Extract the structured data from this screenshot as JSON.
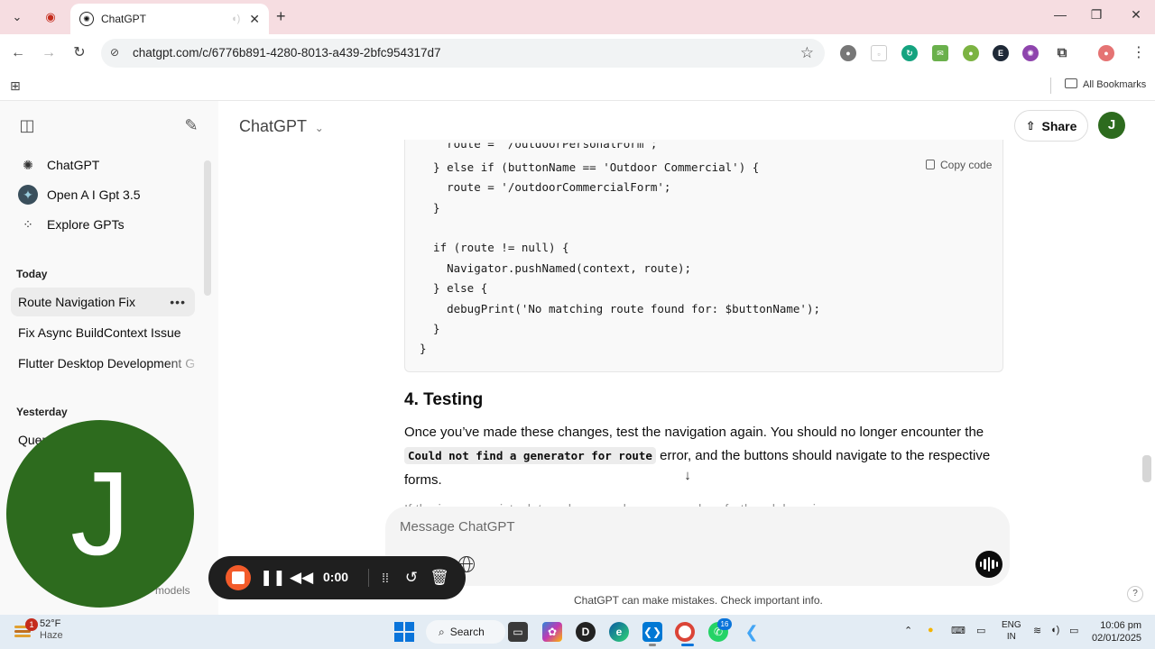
{
  "browser": {
    "tab_title": "ChatGPT",
    "url": "chatgpt.com/c/6776b891-4280-8013-a439-2bfc954317d7",
    "bookmarks_folder": "All Bookmarks",
    "extension_letter": "E"
  },
  "sidebar": {
    "top_items": [
      {
        "label": "ChatGPT",
        "icon": "openai-logo-icon"
      },
      {
        "label": "Open A I Gpt 3.5",
        "icon": "gpt-avatar-icon"
      },
      {
        "label": "Explore GPTs",
        "icon": "grid-icon"
      }
    ],
    "today_label": "Today",
    "today_items": [
      {
        "label": "Route Navigation Fix",
        "active": true
      },
      {
        "label": "Fix Async BuildContext Issue"
      },
      {
        "label": "Flutter Desktop Development Gu"
      }
    ],
    "yesterday_label": "Yesterday",
    "yesterday_partial": "Quer",
    "models_partial": "models"
  },
  "header": {
    "title": "ChatGPT",
    "share_label": "Share",
    "avatar_letter": "J"
  },
  "code": {
    "copy_label": "Copy code",
    "lines": [
      "    route = '/outdoorPersonalForm';",
      "  } else if (buttonName == 'Outdoor Commercial') {",
      "    route = '/outdoorCommercialForm';",
      "  }",
      "",
      "  if (route != null) {",
      "    Navigator.pushNamed(context, route);",
      "  } else {",
      "    debugPrint('No matching route found for: $buttonName');",
      "  }",
      "}"
    ]
  },
  "content": {
    "section_heading": "4. Testing",
    "para_line1": "Once you’ve made these changes, test the navigation again. You should no longer encounter the",
    "inline_code": "Could not find a generator for route",
    "para_line2_rest": " error, and the buttons should navigate to the respective",
    "para_line3": "forms.",
    "partial_line": "If the issue persists, let me know and we can explore further debugging."
  },
  "composer": {
    "placeholder": "Message ChatGPT",
    "disclaimer": "ChatGPT can make mistakes. Check important info.",
    "help": "?"
  },
  "recorder": {
    "webcam_letter": "J",
    "time": "0:00"
  },
  "taskbar": {
    "weather_temp": "52°F",
    "weather_cond": "Haze",
    "weather_badge": "1",
    "search_label": "Search",
    "whatsapp_badge": "16",
    "lang_top": "ENG",
    "lang_bottom": "IN",
    "time": "10:06 pm",
    "date": "02/01/2025"
  },
  "colors": {
    "tabstrip": "#f6dde1",
    "avatar_green": "#2d6b1e",
    "record_orange": "#f35b2a",
    "taskbar": "#e3ecf4"
  }
}
